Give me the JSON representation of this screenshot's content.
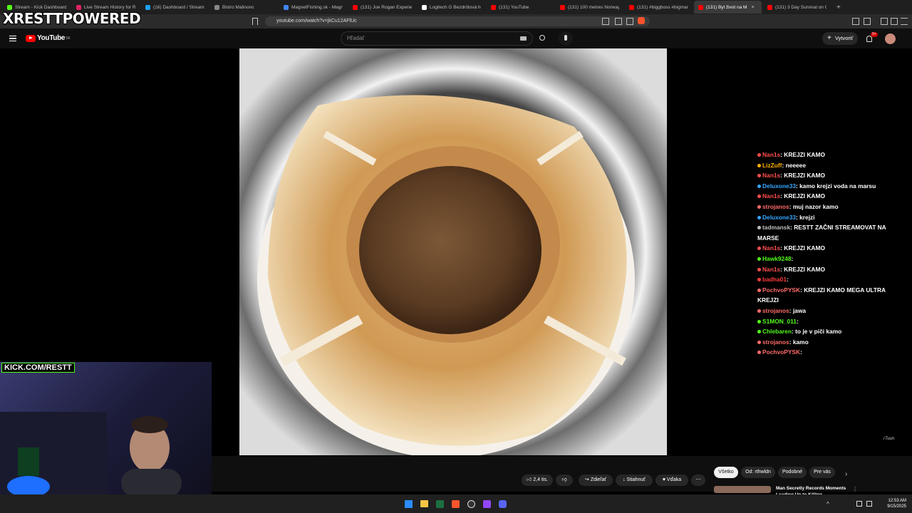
{
  "overlay": {
    "brand": "XRESTTPOWERED",
    "kick_label": "KICK.COM/RESTT"
  },
  "browser": {
    "tabs": [
      {
        "label": "Stream - Kick Dashboard",
        "color": "#53fc18"
      },
      {
        "label": "Live Stream History for Ria",
        "color": "#e0245e"
      },
      {
        "label": "(16) Dashboard / Streamla",
        "color": "#1da1f2"
      },
      {
        "label": "Bistro Malinovo",
        "color": "#888888"
      },
      {
        "label": "MagnetFishing.sk - Magne",
        "color": "#4285f4"
      },
      {
        "label": "(131) Joe Rogan Experienc",
        "color": "#ff0000"
      },
      {
        "label": "Logitech G Bezdrôtová her",
        "color": "#ffffff"
      },
      {
        "label": "(131) YouTube",
        "color": "#ff0000"
      },
      {
        "label": "(131) 100 metres Norway",
        "color": "#ff0000"
      },
      {
        "label": "(131) #biggboss #bigman",
        "color": "#ff0000"
      },
      {
        "label": "(131) Byl život na M",
        "color": "#ff0000",
        "active": true
      },
      {
        "label": "(131) 3 Day Survival on Co",
        "color": "#ff0000"
      }
    ],
    "url": "youtube.com/watch?v=jkCu12AFlUc"
  },
  "youtube": {
    "logo": "YouTube",
    "country": "SK",
    "search_placeholder": "Hľadať",
    "create_label": "Vytvoriť",
    "notif_count": "9+",
    "likes": "2,4 tis.",
    "share_label": "Zdieľať",
    "download_label": "Stiahnuť",
    "thanks_label": "Vďaka",
    "chips": [
      "Všetko",
      "Od: rthwldn",
      "Podobné",
      "Pre vás"
    ],
    "rec_title": "Man Secretly Records Moments",
    "rec_subtitle": "Leading Up to Killing...",
    "watermark": "rTuun"
  },
  "chat": [
    {
      "user": "Nan1s",
      "color": "#ff4d4d",
      "text": "KREJZI KAMO"
    },
    {
      "user": "LizZuff",
      "color": "#ffb000",
      "text": "neeeee"
    },
    {
      "user": "Nan1s",
      "color": "#ff4d4d",
      "text": "KREJZI KAMO"
    },
    {
      "user": "Deluxone33",
      "color": "#35a7ff",
      "text": "kamo krejzi voda na marsu"
    },
    {
      "user": "Nan1s",
      "color": "#ff4d4d",
      "text": "KREJZI KAMO"
    },
    {
      "user": "strojanos",
      "color": "#ff6b6b",
      "text": "muj nazor kamo"
    },
    {
      "user": "Deluxone33",
      "color": "#35a7ff",
      "text": "krejzi"
    },
    {
      "user": "tadmansk",
      "color": "#bfbfbf",
      "text": "RESTT ZAČNI STREAMOVAT NA MARSE"
    },
    {
      "user": "Nan1s",
      "color": "#ff4d4d",
      "text": "KREJZI KAMO"
    },
    {
      "user": "Hawk9248",
      "color": "#53fc18",
      "text": ""
    },
    {
      "user": "Nan1s",
      "color": "#ff4d4d",
      "text": "KREJZI KAMO"
    },
    {
      "user": "badha01",
      "color": "#ff3a3a",
      "text": ""
    },
    {
      "user": "PochvoPYSK",
      "color": "#ff6b6b",
      "text": "KREJZI KAMO MEGA ULTRA KREJZI"
    },
    {
      "user": "strojanos",
      "color": "#ff6b6b",
      "text": "jawa"
    },
    {
      "user": "S1MON_011",
      "color": "#53fc18",
      "text": ""
    },
    {
      "user": "Chlebaren",
      "color": "#53fc18",
      "text": "to je v piči kamo"
    },
    {
      "user": "strojanos",
      "color": "#ff6b6b",
      "text": "kamo"
    },
    {
      "user": "PochvoPYSK",
      "color": "#ff6b6b",
      "text": ""
    }
  ],
  "taskbar": {
    "time": "12:53 AM",
    "date": "9/15/2025"
  }
}
